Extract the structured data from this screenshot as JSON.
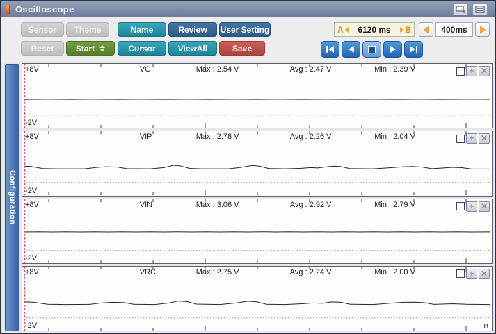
{
  "window": {
    "title": "Oscilloscope"
  },
  "titlebar": {
    "icons": [
      {
        "name": "app-icon"
      },
      {
        "name": "display-switch-icon"
      },
      {
        "name": "layout-icon"
      }
    ]
  },
  "toolbar": {
    "buttons_row1": [
      {
        "label": "Sensor",
        "state": "disabled"
      },
      {
        "label": "Theme",
        "state": "disabled"
      },
      {
        "label": "Name",
        "state": "teal"
      },
      {
        "label": "Review",
        "state": "blue"
      },
      {
        "label": "User Setting",
        "state": "blue"
      }
    ],
    "buttons_row2": [
      {
        "label": "Reset",
        "state": "disabled"
      },
      {
        "label": "Start",
        "state": "green",
        "has_spinner": true
      },
      {
        "label": "Cursor",
        "state": "teal"
      },
      {
        "label": "ViewAll",
        "state": "teal"
      },
      {
        "label": "Save",
        "state": "red"
      }
    ],
    "ab_range": {
      "a_label": "A",
      "value": "6120 ms",
      "b_label": "B"
    },
    "timebase": {
      "value": "400ms"
    },
    "playback": [
      "skip-start",
      "step-back",
      "stop",
      "play",
      "skip-end"
    ]
  },
  "sidebar": {
    "label": "Configuration"
  },
  "icons": {
    "plus": "+",
    "close": "✕"
  },
  "cursors": {
    "a_color": "#e04040",
    "b_label": "B",
    "b_color": "#222222"
  },
  "colors": {
    "titlebar": "#7c8cab",
    "teal": "#2d9aae",
    "blue": "#3a6da1",
    "red": "#c0504d",
    "green": "#668f38",
    "orange_accent": "#f0a23c",
    "cream": "#f8f4e3",
    "playback_blue": "#2f7fc4",
    "config_tab": "#3c6cb4"
  },
  "channels": [
    {
      "name": "VG",
      "top_label": "+8V",
      "bottom_label": "-2V",
      "max": "Max : 2.54 V",
      "avg": "Avg : 2.47 V",
      "min": "Min : 2.39 V"
    },
    {
      "name": "VIP",
      "top_label": "+8V",
      "bottom_label": "-2V",
      "max": "Max : 2.78 V",
      "avg": "Avg : 2.26 V",
      "min": "Min : 2.04 V"
    },
    {
      "name": "VIN",
      "top_label": "+8V",
      "bottom_label": "-2V",
      "max": "Max : 3.06 V",
      "avg": "Avg : 2.92 V",
      "min": "Min : 2.79 V"
    },
    {
      "name": "VRC",
      "top_label": "+8V",
      "bottom_label": "-2V",
      "max": "Max : 2.75 V",
      "avg": "Avg : 2.24 V",
      "min": "Min : 2.00 V"
    }
  ],
  "chart_data": [
    {
      "type": "line",
      "name": "VG",
      "ylim": [
        -2,
        8
      ],
      "x_range_ms": [
        0,
        6120
      ],
      "stats": {
        "max": 2.54,
        "avg": 2.47,
        "min": 2.39
      },
      "points": [
        [
          0,
          2.46
        ],
        [
          0.05,
          2.48
        ],
        [
          0.1,
          2.46
        ],
        [
          0.15,
          2.49
        ],
        [
          0.2,
          2.46
        ],
        [
          0.25,
          2.48
        ],
        [
          0.3,
          2.46
        ],
        [
          0.35,
          2.48
        ],
        [
          0.4,
          2.46
        ],
        [
          0.45,
          2.48
        ],
        [
          0.5,
          2.46
        ],
        [
          0.55,
          2.48
        ],
        [
          0.6,
          2.46
        ],
        [
          0.65,
          2.48
        ],
        [
          0.7,
          2.46
        ],
        [
          0.75,
          2.48
        ],
        [
          0.8,
          2.46
        ],
        [
          0.85,
          2.48
        ],
        [
          0.9,
          2.46
        ],
        [
          0.95,
          2.48
        ],
        [
          1,
          2.47
        ]
      ]
    },
    {
      "type": "line",
      "name": "VIP",
      "ylim": [
        -2,
        8
      ],
      "x_range_ms": [
        0,
        6120
      ],
      "stats": {
        "max": 2.78,
        "avg": 2.26,
        "min": 2.04
      },
      "points": [
        [
          0,
          2.55
        ],
        [
          0.015,
          2.5
        ],
        [
          0.04,
          2.17
        ],
        [
          0.07,
          2.13
        ],
        [
          0.13,
          2.14
        ],
        [
          0.155,
          2.35
        ],
        [
          0.175,
          2.46
        ],
        [
          0.2,
          2.4
        ],
        [
          0.22,
          2.16
        ],
        [
          0.27,
          2.13
        ],
        [
          0.3,
          2.32
        ],
        [
          0.32,
          2.68
        ],
        [
          0.335,
          2.6
        ],
        [
          0.355,
          2.2
        ],
        [
          0.38,
          2.13
        ],
        [
          0.44,
          2.14
        ],
        [
          0.465,
          2.35
        ],
        [
          0.49,
          2.66
        ],
        [
          0.505,
          2.55
        ],
        [
          0.525,
          2.18
        ],
        [
          0.56,
          2.13
        ],
        [
          0.595,
          2.22
        ],
        [
          0.615,
          2.32
        ],
        [
          0.63,
          2.27
        ],
        [
          0.65,
          2.45
        ],
        [
          0.665,
          2.55
        ],
        [
          0.68,
          2.48
        ],
        [
          0.7,
          2.16
        ],
        [
          0.75,
          2.13
        ],
        [
          0.79,
          2.32
        ],
        [
          0.815,
          2.46
        ],
        [
          0.835,
          2.5
        ],
        [
          0.855,
          2.4
        ],
        [
          0.875,
          2.16
        ],
        [
          0.9,
          2.26
        ],
        [
          0.92,
          2.36
        ],
        [
          0.94,
          2.3
        ],
        [
          0.96,
          2.12
        ],
        [
          1,
          2.1
        ]
      ]
    },
    {
      "type": "line",
      "name": "VIN",
      "ylim": [
        -2,
        8
      ],
      "x_range_ms": [
        0,
        6120
      ],
      "stats": {
        "max": 3.06,
        "avg": 2.92,
        "min": 2.79
      },
      "points": [
        [
          0,
          2.9
        ],
        [
          0.03,
          2.94
        ],
        [
          0.06,
          2.9
        ],
        [
          0.09,
          2.94
        ],
        [
          0.12,
          2.9
        ],
        [
          0.15,
          2.94
        ],
        [
          0.18,
          2.9
        ],
        [
          0.21,
          2.94
        ],
        [
          0.24,
          2.9
        ],
        [
          0.27,
          2.94
        ],
        [
          0.3,
          2.9
        ],
        [
          0.33,
          2.94
        ],
        [
          0.36,
          2.9
        ],
        [
          0.39,
          2.94
        ],
        [
          0.42,
          2.9
        ],
        [
          0.45,
          2.94
        ],
        [
          0.48,
          2.9
        ],
        [
          0.51,
          2.94
        ],
        [
          0.54,
          2.9
        ],
        [
          0.57,
          2.94
        ],
        [
          0.6,
          2.9
        ],
        [
          0.63,
          2.94
        ],
        [
          0.66,
          2.9
        ],
        [
          0.69,
          2.94
        ],
        [
          0.72,
          2.9
        ],
        [
          0.75,
          2.94
        ],
        [
          0.78,
          2.9
        ],
        [
          0.81,
          2.94
        ],
        [
          0.84,
          2.9
        ],
        [
          0.87,
          2.94
        ],
        [
          0.9,
          2.9
        ],
        [
          0.93,
          2.94
        ],
        [
          0.96,
          2.9
        ],
        [
          1,
          2.92
        ]
      ]
    },
    {
      "type": "line",
      "name": "VRC",
      "ylim": [
        -2,
        8
      ],
      "x_range_ms": [
        0,
        6120
      ],
      "stats": {
        "max": 2.75,
        "avg": 2.24,
        "min": 2.0
      },
      "points": [
        [
          0,
          2.5
        ],
        [
          0.02,
          2.44
        ],
        [
          0.05,
          2.12
        ],
        [
          0.09,
          2.08
        ],
        [
          0.14,
          2.1
        ],
        [
          0.165,
          2.32
        ],
        [
          0.19,
          2.44
        ],
        [
          0.215,
          2.38
        ],
        [
          0.235,
          2.12
        ],
        [
          0.28,
          2.08
        ],
        [
          0.31,
          2.3
        ],
        [
          0.33,
          2.62
        ],
        [
          0.35,
          2.52
        ],
        [
          0.37,
          2.14
        ],
        [
          0.42,
          2.08
        ],
        [
          0.455,
          2.32
        ],
        [
          0.48,
          2.6
        ],
        [
          0.5,
          2.5
        ],
        [
          0.52,
          2.12
        ],
        [
          0.56,
          2.08
        ],
        [
          0.6,
          2.22
        ],
        [
          0.62,
          2.32
        ],
        [
          0.64,
          2.26
        ],
        [
          0.66,
          2.48
        ],
        [
          0.68,
          2.42
        ],
        [
          0.7,
          2.12
        ],
        [
          0.75,
          2.08
        ],
        [
          0.79,
          2.3
        ],
        [
          0.815,
          2.42
        ],
        [
          0.84,
          2.45
        ],
        [
          0.86,
          2.36
        ],
        [
          0.88,
          2.1
        ],
        [
          0.92,
          2.2
        ],
        [
          0.95,
          2.12
        ],
        [
          1,
          2.08
        ]
      ]
    }
  ]
}
